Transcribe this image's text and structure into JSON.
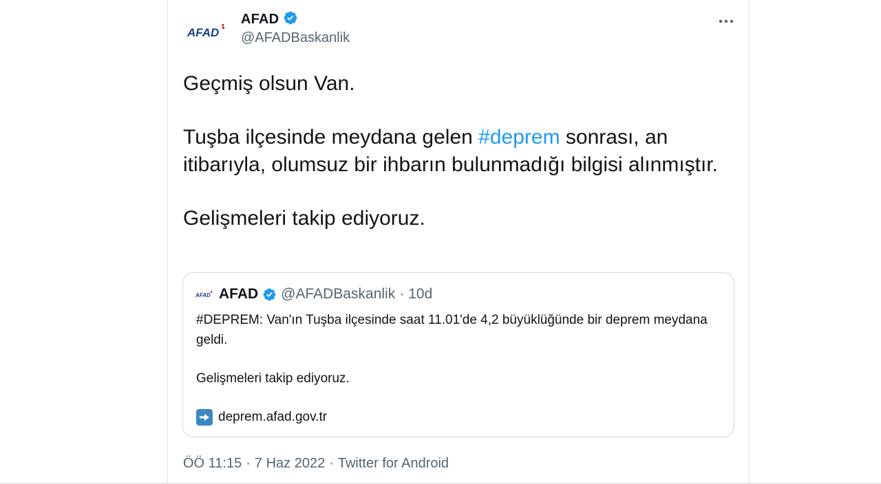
{
  "tweet": {
    "author": {
      "name": "AFAD",
      "handle": "@AFADBaskanlik",
      "avatar_text": "AFAD",
      "verified": true
    },
    "text": {
      "line1": "Geçmiş olsun Van.",
      "para2_pre": "Tuşba ilçesinde meydana gelen ",
      "para2_hashtag": "#deprem",
      "para2_post": " sonrası, an itibarıyla, olumsuz bir ihbarın bulunmadığı bilgisi alınmıştır.",
      "para3": "Gelişmeleri takip ediyoruz."
    },
    "quoted": {
      "name": "AFAD",
      "handle": "@AFADBaskanlik",
      "separator": "·",
      "time": "10d",
      "avatar_text": "AFAD",
      "text_line1": "#DEPREM: Van'ın Tuşba ilçesinde saat 11.01'de 4,2 büyüklüğünde bir deprem meydana geldi.",
      "text_line2": "Gelişmeleri takip ediyoruz.",
      "link": "deprem.afad.gov.tr",
      "link_icon": "right-arrow-icon"
    },
    "meta": {
      "time": "ÖÖ 11:15",
      "sep1": "·",
      "date": "7 Haz 2022",
      "sep2": "·",
      "source": "Twitter for Android"
    }
  },
  "colors": {
    "accent": "#1d9bf0",
    "secondary_text": "#536471",
    "primary_text": "#0f1419",
    "brand_blue": "#1a3e8c",
    "brand_red": "#e3262e",
    "border": "#cfd9de"
  },
  "icons": {
    "verified": "verified-badge-icon",
    "more": "more-options-icon"
  }
}
